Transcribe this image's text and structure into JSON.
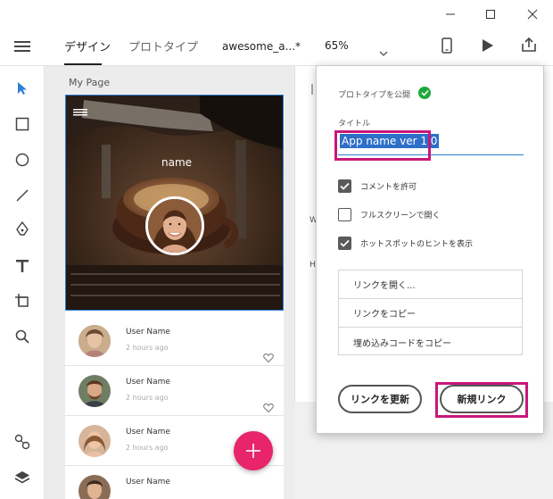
{
  "window": {
    "controls": [
      "minimize-icon",
      "maximize-icon",
      "close-icon"
    ]
  },
  "header": {
    "tabs": [
      {
        "label": "デザイン",
        "active": true
      },
      {
        "label": "プロトタイプ",
        "active": false
      }
    ],
    "filename": "awesome_a...*",
    "zoom": "65%"
  },
  "canvas": {
    "page_label": "My Page",
    "hero_name": "name",
    "list": [
      {
        "name": "User Name",
        "time": "2 hours ago"
      },
      {
        "name": "User Name",
        "time": "2 hours ago"
      },
      {
        "name": "User Name",
        "time": "2 hours ago"
      },
      {
        "name": "User Name",
        "time": ""
      }
    ]
  },
  "share_popup": {
    "publish_label": "プロトタイプを公開",
    "title_label": "タイトル",
    "title_value": "App name ver 1.0",
    "options": [
      {
        "label": "コメントを許可",
        "checked": true
      },
      {
        "label": "フルスクリーンで開く",
        "checked": false
      },
      {
        "label": "ホットスポットのヒントを表示",
        "checked": true
      }
    ],
    "link_menu": [
      "リンクを開く...",
      "リンクをコピー",
      "埋め込みコードをコピー"
    ],
    "update_button": "リンクを更新",
    "new_link_button": "新規リンク"
  },
  "colors": {
    "accent_blue": "#2d7fd3",
    "highlight_magenta": "#c8177a",
    "fab_pink": "#e8246a",
    "success_green": "#1fa93b"
  }
}
